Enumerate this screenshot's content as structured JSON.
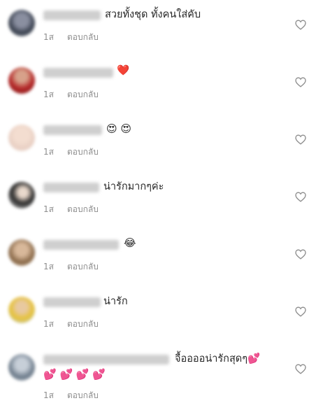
{
  "comments": [
    {
      "text": "สวยทั้งชุด ทั้งคนใส่คับ",
      "time": "1ส",
      "reply_label": "ตอบกลับ"
    },
    {
      "text": "❤️",
      "time": "1ส",
      "reply_label": "ตอบกลับ"
    },
    {
      "text": "😍 😍",
      "time": "1ส",
      "reply_label": "ตอบกลับ"
    },
    {
      "text": "น่ารักมากๆค่ะ",
      "time": "1ส",
      "reply_label": "ตอบกลับ"
    },
    {
      "text": "😂",
      "time": "1ส",
      "reply_label": "ตอบกลับ"
    },
    {
      "text": "น่ารัก",
      "time": "1ส",
      "reply_label": "ตอบกลับ"
    },
    {
      "text": "จื้ออออน่ารักสุดๆ💕",
      "text_line2": "💕 💕 💕 💕",
      "time": "1ส",
      "reply_label": "ตอบกลับ"
    }
  ],
  "icons": {
    "like": "heart-outline-icon"
  },
  "colors": {
    "text": "#262626",
    "meta": "#8e8e8e",
    "heart_red": "#ed1c3a",
    "heart_pink": "#f0509a"
  }
}
